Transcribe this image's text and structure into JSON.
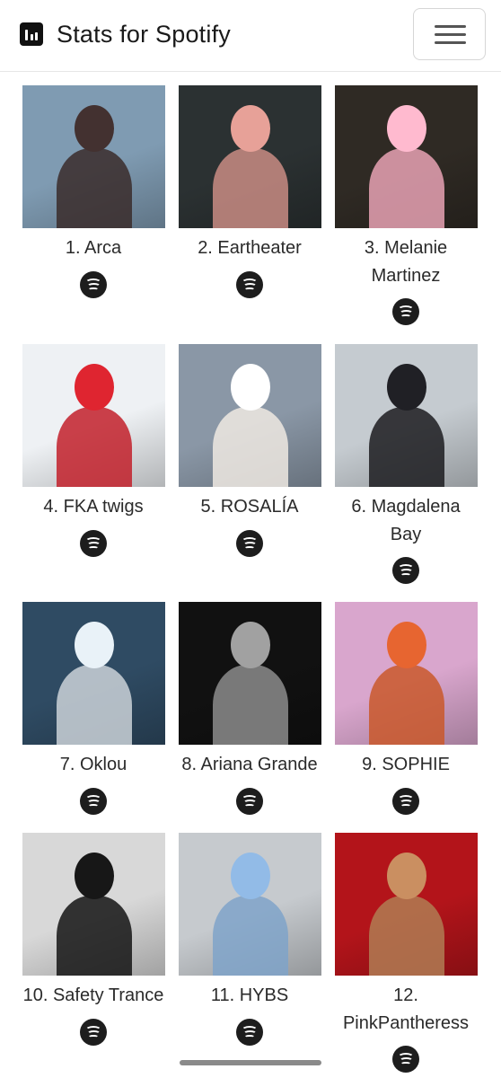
{
  "app": {
    "title": "Stats for Spotify",
    "logo_icon": "bar-chart-icon",
    "menu_icon": "hamburger-menu-icon"
  },
  "artists": [
    {
      "rank_label": "1. Arca",
      "icon": "spotify-icon",
      "bg": "#7f9bb2",
      "accent": "#3a2b2a"
    },
    {
      "rank_label": "2. Eartheater",
      "icon": "spotify-icon",
      "bg": "#2b3132",
      "accent": "#c98c84"
    },
    {
      "rank_label": "3. Melanie Martinez",
      "icon": "spotify-icon",
      "bg": "#2f2a24",
      "accent": "#e7a2b4"
    },
    {
      "rank_label": "4. FKA twigs",
      "icon": "spotify-icon",
      "bg": "#eef1f4",
      "accent": "#c2202a"
    },
    {
      "rank_label": "5. ROSALÍA",
      "icon": "spotify-icon",
      "bg": "#8a97a6",
      "accent": "#efe9e2"
    },
    {
      "rank_label": "6. Magdalena Bay",
      "icon": "spotify-icon",
      "bg": "#c5cbd0",
      "accent": "#1c1c20"
    },
    {
      "rank_label": "7. Oklou",
      "icon": "spotify-icon",
      "bg": "#2f4b63",
      "accent": "#cbd2d8"
    },
    {
      "rank_label": "8. Ariana Grande",
      "icon": "spotify-icon",
      "bg": "#111111",
      "accent": "#8c8c8c"
    },
    {
      "rank_label": "9. SOPHIE",
      "icon": "spotify-icon",
      "bg": "#d9a6cd",
      "accent": "#c9582a"
    },
    {
      "rank_label": "10. Safety Trance",
      "icon": "spotify-icon",
      "bg": "#d8d8d8",
      "accent": "#141414"
    },
    {
      "rank_label": "11. HYBS",
      "icon": "spotify-icon",
      "bg": "#c6cace",
      "accent": "#7fa3c9"
    },
    {
      "rank_label": "12. PinkPantheress",
      "icon": "spotify-icon",
      "bg": "#b3141a",
      "accent": "#b07c54"
    }
  ]
}
